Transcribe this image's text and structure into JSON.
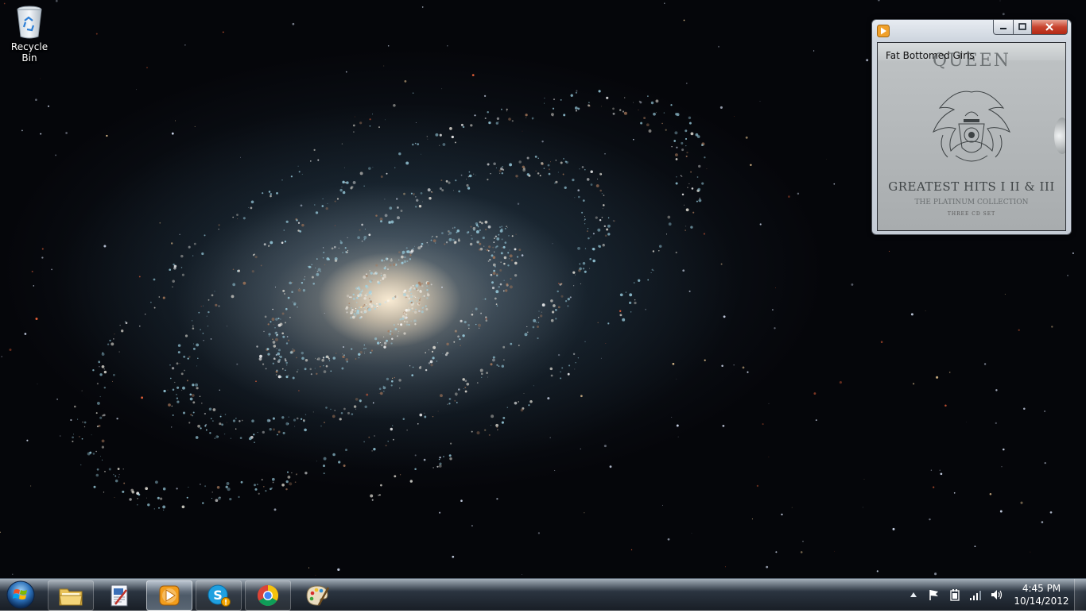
{
  "desktop": {
    "icons": [
      {
        "label": "Recycle Bin",
        "icon": "recycle-bin-icon"
      }
    ]
  },
  "player": {
    "track_title": "Fat Bottomed Girls",
    "album_art": {
      "band": "QUEEN",
      "album": "GREATEST HITS I II & III",
      "subtitle": "THE PLATINUM COLLECTION",
      "set": "THREE CD SET"
    }
  },
  "taskbar": {
    "start": {
      "icon": "windows-orb-icon"
    },
    "buttons": [
      {
        "app": "windows-explorer",
        "icon": "folder-icon",
        "active": false
      },
      {
        "app": "paint-document",
        "icon": "document-pen-icon",
        "active": false
      },
      {
        "app": "windows-media-player",
        "icon": "media-player-icon",
        "active": true
      },
      {
        "app": "skype",
        "icon": "skype-icon",
        "badge": "!",
        "active": false
      },
      {
        "app": "google-chrome",
        "icon": "chrome-icon",
        "active": false
      },
      {
        "app": "paint",
        "icon": "palette-icon",
        "active": false
      }
    ],
    "tray": {
      "icons": [
        "show-hidden-icon",
        "action-center-flag-icon",
        "power-icon",
        "network-signal-icon",
        "volume-icon"
      ],
      "time": "4:45 PM",
      "date": "10/14/2012"
    }
  },
  "colors": {
    "close_button": "#c8452f",
    "taskbar": "#131b25"
  }
}
